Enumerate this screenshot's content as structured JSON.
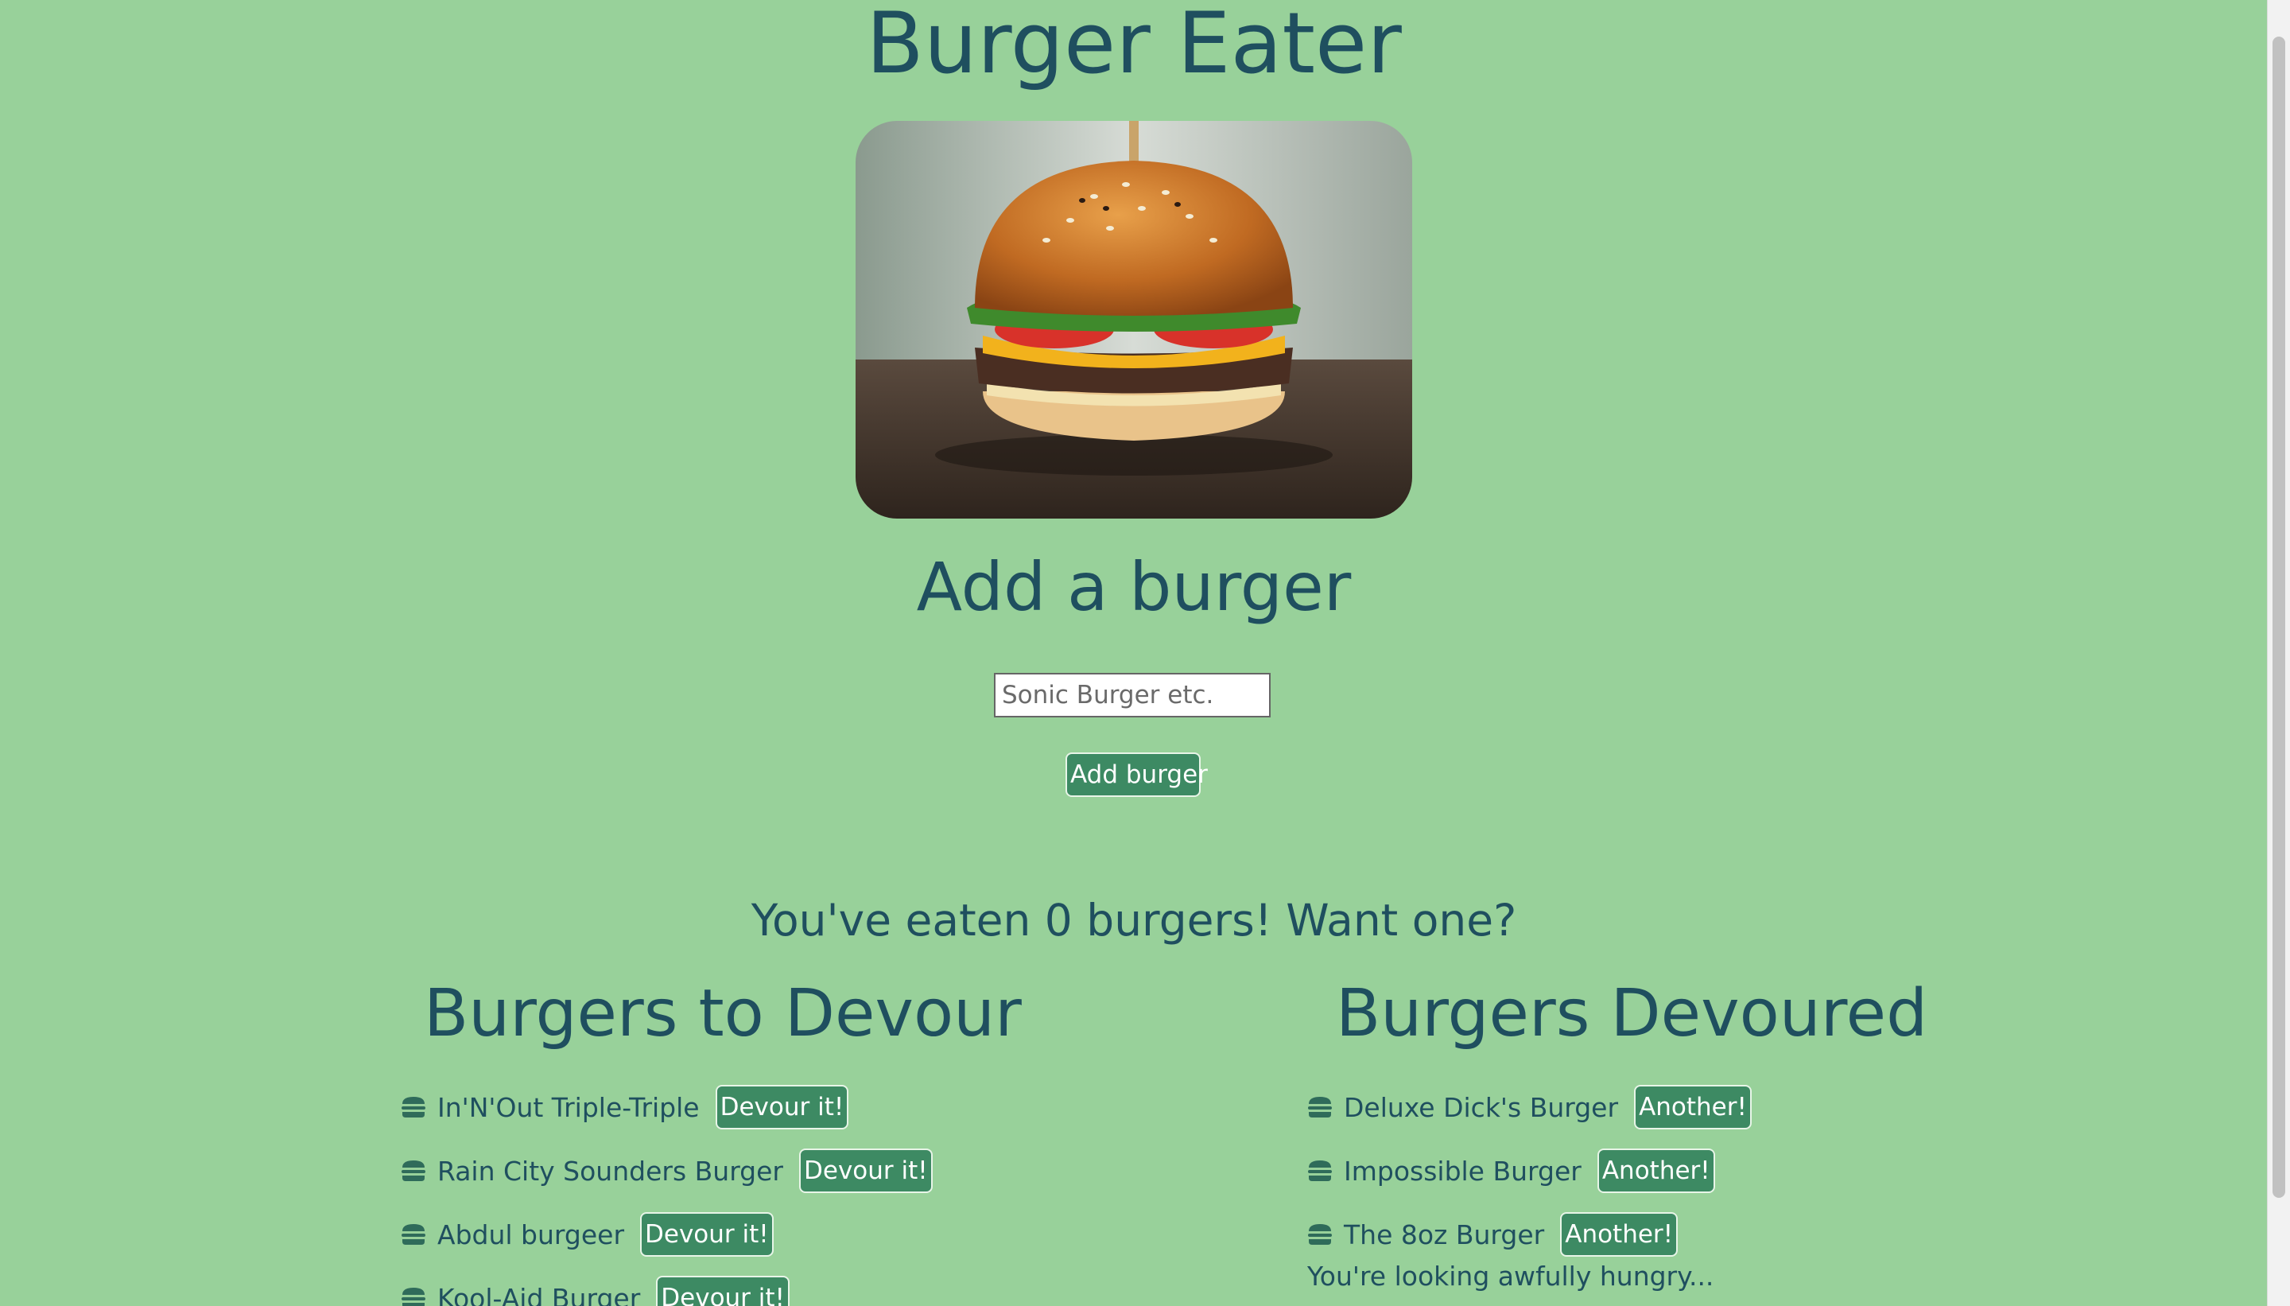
{
  "page": {
    "title": "Burger Eater",
    "add_heading": "Add a burger",
    "input_placeholder": "Sonic Burger etc.",
    "add_button_label": "Add burger",
    "eaten_message": "You've eaten 0 burgers! Want one?",
    "hungry_message": "You're looking awfully hungry..."
  },
  "to_devour": {
    "heading": "Burgers to Devour",
    "button_label": "Devour it!",
    "items": [
      {
        "name": "In'N'Out Triple-Triple"
      },
      {
        "name": "Rain City Sounders Burger"
      },
      {
        "name": "Abdul burgeer"
      },
      {
        "name": "Kool-Aid Burger"
      }
    ]
  },
  "devoured": {
    "heading": "Burgers Devoured",
    "button_label": "Another!",
    "items": [
      {
        "name": "Deluxe Dick's Burger"
      },
      {
        "name": "Impossible Burger"
      },
      {
        "name": "The 8oz Burger"
      }
    ]
  },
  "icons": {
    "list_item_icon": "hamburger-icon"
  },
  "colors": {
    "background": "#98d19a",
    "text": "#1f4f5f",
    "button": "#3d8a63"
  }
}
